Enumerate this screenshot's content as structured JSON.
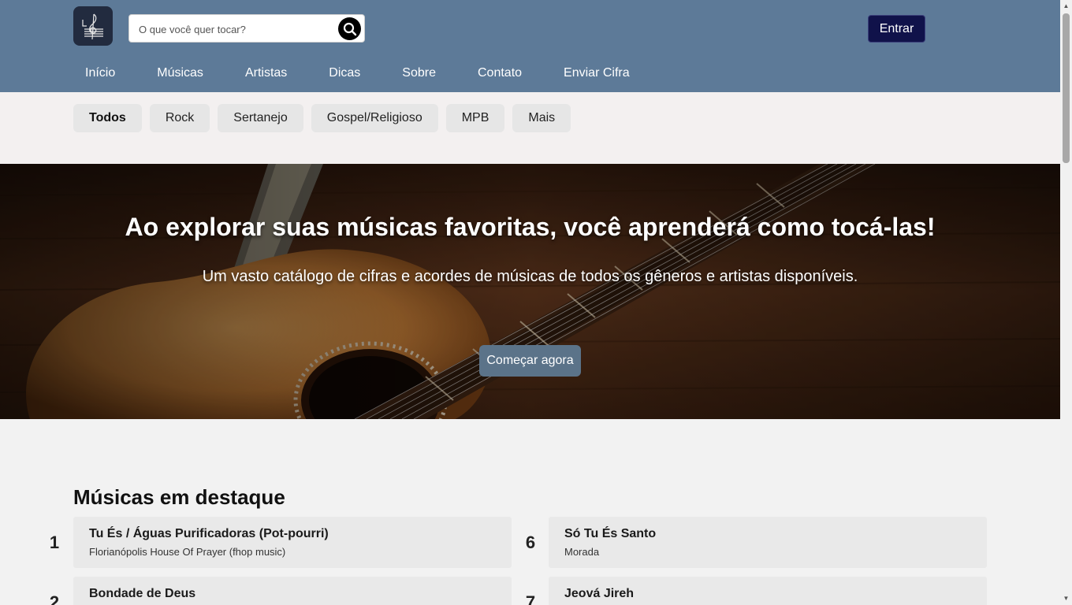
{
  "header": {
    "search_placeholder": "O que você quer tocar?",
    "login_label": "Entrar",
    "colors": {
      "bar": "#5d7a98",
      "login": "#10124a"
    }
  },
  "nav": {
    "items": [
      {
        "label": "Início"
      },
      {
        "label": "Músicas"
      },
      {
        "label": "Artistas"
      },
      {
        "label": "Dicas"
      },
      {
        "label": "Sobre"
      },
      {
        "label": "Contato"
      },
      {
        "label": "Enviar Cifra"
      }
    ]
  },
  "genres": {
    "items": [
      {
        "label": "Todos",
        "active": true
      },
      {
        "label": "Rock"
      },
      {
        "label": "Sertanejo"
      },
      {
        "label": "Gospel/Religioso"
      },
      {
        "label": "MPB"
      },
      {
        "label": "Mais"
      }
    ]
  },
  "hero": {
    "title": "Ao explorar suas músicas favoritas, você aprenderá como tocá-las!",
    "subtitle": "Um vasto catálogo de cifras e acordes de músicas de todos os gêneros e artistas disponíveis.",
    "cta_label": "Começar agora"
  },
  "featured": {
    "title": "Músicas em destaque",
    "left": [
      {
        "rank": "1",
        "title": "Tu És / Águas Purificadoras (Pot-pourri)",
        "artist": "Florianópolis House Of Prayer (fhop music)"
      },
      {
        "rank": "2",
        "title": "Bondade de Deus",
        "artist": ""
      }
    ],
    "right": [
      {
        "rank": "6",
        "title": "Só Tu És Santo",
        "artist": "Morada"
      },
      {
        "rank": "7",
        "title": "Jeová Jireh",
        "artist": ""
      }
    ]
  }
}
